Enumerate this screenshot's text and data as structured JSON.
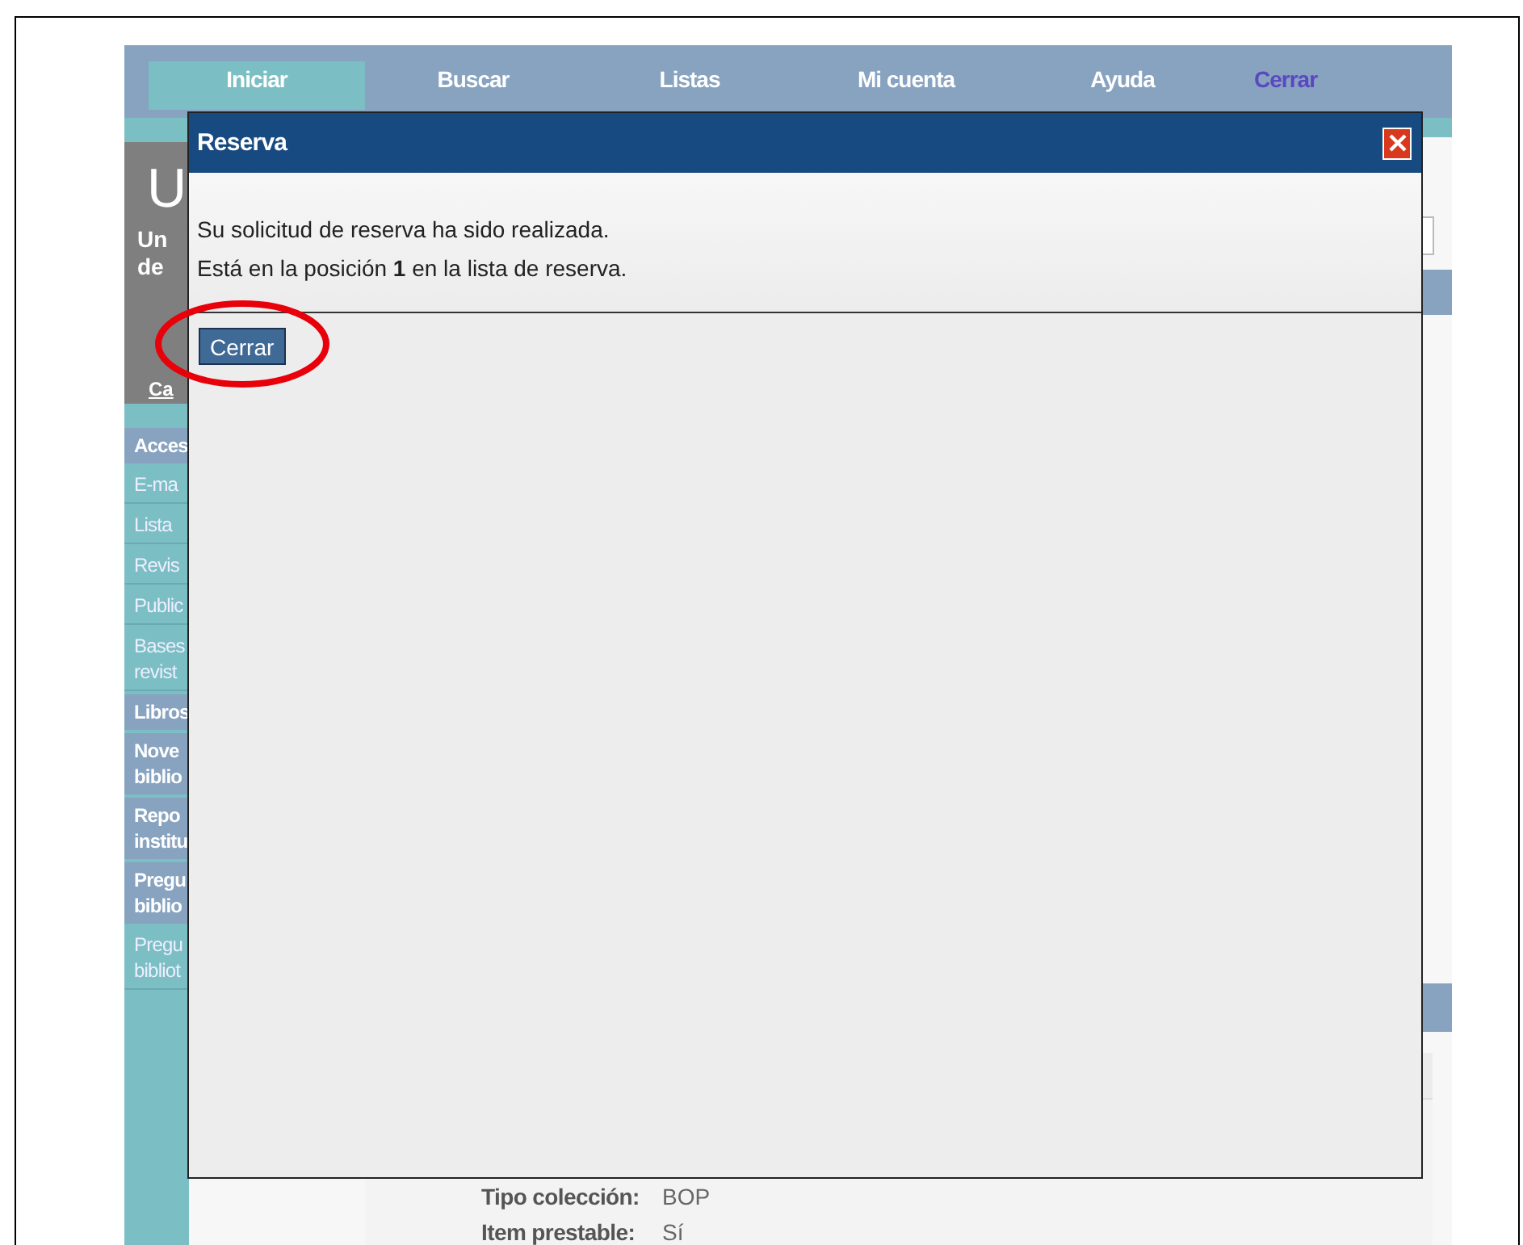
{
  "nav": {
    "tabs": [
      {
        "label": "Iniciar",
        "selected": true,
        "disabled": false
      },
      {
        "label": "Buscar",
        "selected": false,
        "disabled": false
      },
      {
        "label": "Listas",
        "selected": false,
        "disabled": false
      },
      {
        "label": "Mi cuenta",
        "selected": false,
        "disabled": false
      },
      {
        "label": "Ayuda",
        "selected": false,
        "disabled": false
      },
      {
        "label": "Cerrar",
        "selected": false,
        "disabled": true
      }
    ]
  },
  "sidebar": {
    "logo_letter": "U",
    "title_lines": [
      "Un",
      "de"
    ],
    "link": "Ca",
    "items": [
      {
        "label": "Acces",
        "kind": "header"
      },
      {
        "label": "E-ma",
        "kind": "link"
      },
      {
        "label": "Lista",
        "kind": "link"
      },
      {
        "label": "Revis",
        "kind": "link"
      },
      {
        "label": "Public",
        "kind": "link"
      },
      {
        "label": "Bases revist",
        "kind": "link"
      },
      {
        "label": "Libros",
        "kind": "header"
      },
      {
        "label": "Nove biblio",
        "kind": "header"
      },
      {
        "label": "Repo institu",
        "kind": "header"
      },
      {
        "label": "Pregu biblio",
        "kind": "header"
      },
      {
        "label": "Pregu bibliot",
        "kind": "link"
      }
    ]
  },
  "details": {
    "rows": [
      {
        "label": "Tipo colección:",
        "value": "BOP"
      },
      {
        "label": "Item prestable:",
        "value": "Sí"
      }
    ]
  },
  "dialog": {
    "title": "Reserva",
    "message_lines": [
      "Su solicitud de reserva ha sido realizada.",
      "Está en la posición **1** en la lista de reserva."
    ],
    "button": "Cerrar",
    "highlighted": true
  }
}
